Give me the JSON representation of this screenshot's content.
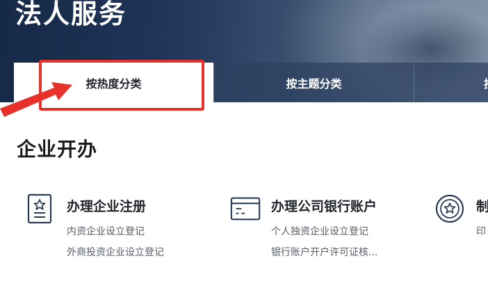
{
  "banner": {
    "title": "法人服务"
  },
  "tabs": [
    {
      "label": "按热度分类",
      "active": true
    },
    {
      "label": "按主题分类",
      "active": false
    },
    {
      "label": "按",
      "active": false
    }
  ],
  "annotation": {
    "color": "#e8312b"
  },
  "section": {
    "title": "企业开办"
  },
  "services": [
    {
      "name": "办理企业注册",
      "icon": "certificate-star-icon",
      "links": [
        "内资企业设立登记",
        "外商投资企业设立登记"
      ]
    },
    {
      "name": "办理公司银行账户",
      "icon": "bank-card-icon",
      "links": [
        "个人独资企业设立登记",
        "银行账户开户许可证核..."
      ]
    },
    {
      "name": "制",
      "icon": "star-seal-icon",
      "links": [
        "印"
      ]
    }
  ],
  "colors": {
    "banner": "#1d3356",
    "accent_red": "#e8312b",
    "text": "#1f2329",
    "subtext": "#555c66"
  }
}
